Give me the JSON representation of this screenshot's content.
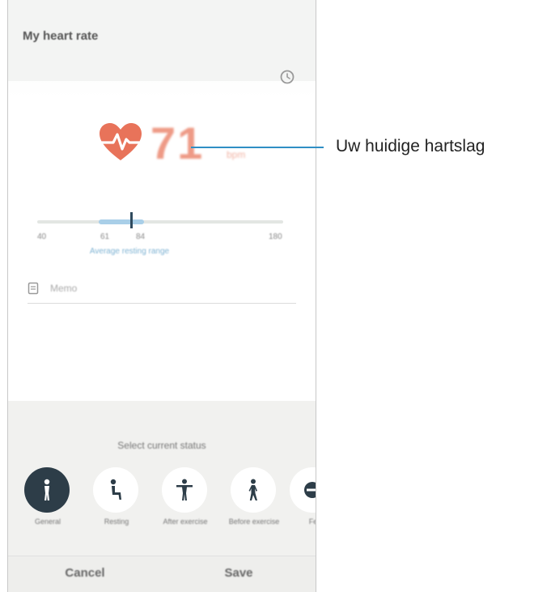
{
  "app": {
    "title": "My heart rate"
  },
  "measurement": {
    "bpm": "71",
    "unit": "bpm"
  },
  "range": {
    "ticks": [
      "40",
      "61",
      "84",
      "180"
    ],
    "caption": "Average resting range"
  },
  "memo": {
    "placeholder": "Memo"
  },
  "status_sheet": {
    "title": "Select current status",
    "items": [
      {
        "label": "General",
        "icon": "person-standing-icon",
        "selected": true
      },
      {
        "label": "Resting",
        "icon": "person-sitting-icon",
        "selected": false
      },
      {
        "label": "After exercise",
        "icon": "person-exercise-icon",
        "selected": false
      },
      {
        "label": "Before exercise",
        "icon": "person-walking-icon",
        "selected": false
      },
      {
        "label": "Fe",
        "icon": "status-icon",
        "selected": false
      }
    ]
  },
  "actions": {
    "cancel": "Cancel",
    "save": "Save"
  },
  "callout": {
    "text": "Uw huidige hartslag"
  },
  "colors": {
    "heart": "#e8735a",
    "bpm": "#ee9a86",
    "selected_status": "#2d3d48",
    "range_fill": "#a9cfe8",
    "callout_line": "#2f8fc5"
  }
}
